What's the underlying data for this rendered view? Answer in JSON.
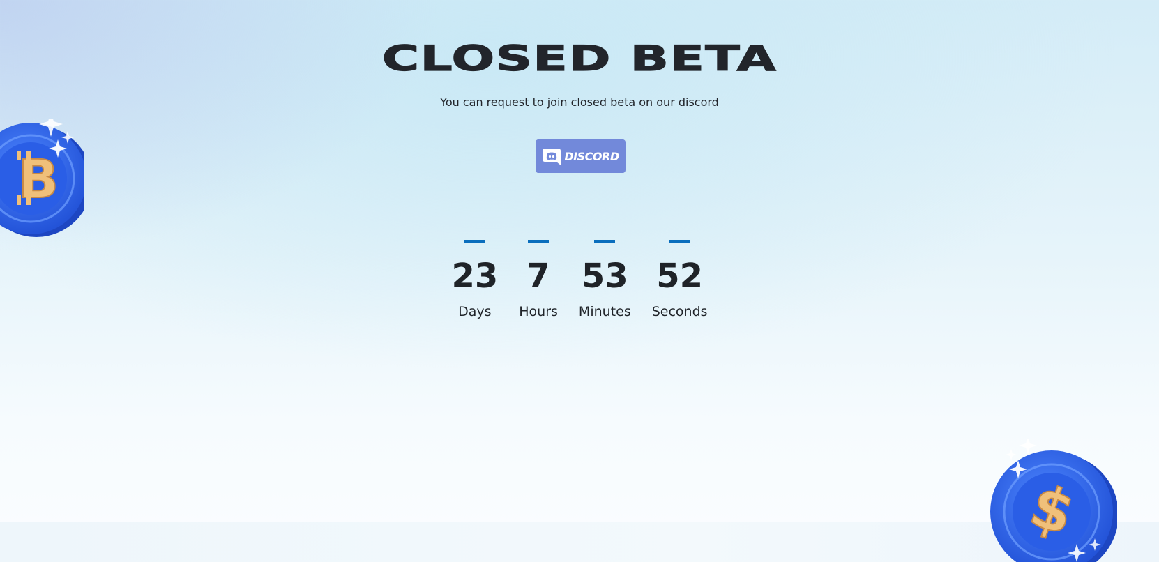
{
  "hero": {
    "title": "CLOSED BETA",
    "subtitle": "You can request to join closed beta on our discord"
  },
  "discord_button": {
    "label": "DISCORD",
    "color": "#7289da"
  },
  "countdown": {
    "accent_color": "#0a6ebd",
    "units": [
      {
        "value": "23",
        "label": "Days"
      },
      {
        "value": "7",
        "label": "Hours"
      },
      {
        "value": "53",
        "label": "Minutes"
      },
      {
        "value": "52",
        "label": "Seconds"
      }
    ]
  },
  "decorations": {
    "coin_left_icon": "bitcoin-coin-icon",
    "coin_right_icon": "dollar-coin-icon",
    "coin_color": "#3a6cf0",
    "symbol_color": "#f0c07a"
  }
}
